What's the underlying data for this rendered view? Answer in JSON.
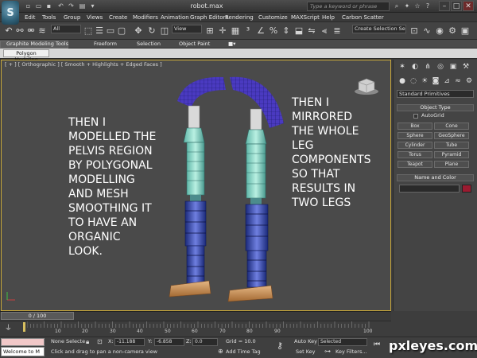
{
  "app": {
    "logo_glyph": "S",
    "window_title": "robot.max",
    "search_placeholder": "Type a keyword or phrase"
  },
  "menu": [
    "Edit",
    "Tools",
    "Group",
    "Views",
    "Create",
    "Modifiers",
    "Animation",
    "Graph Editors",
    "Rendering",
    "Customize",
    "MAXScript",
    "Help",
    "Carbon Scatter"
  ],
  "toolbar": {
    "selection_filter": "All",
    "reference_coord": "View",
    "named_selection": "Create Selection Se"
  },
  "ribbon": {
    "tabs": [
      "Graphite Modeling Tools",
      "Freeform",
      "Selection",
      "Object Paint"
    ],
    "subtab": "Polygon Modeling"
  },
  "viewport": {
    "label": "[ + ] [ Orthographic ] [ Smooth + Highlights + Edged Faces ]",
    "note_left": "THEN I\nMODELLED THE\nPELVIS REGION\nBY POLYGONAL\nMODELLING\nAND MESH\nSMOOTHING IT\nTO HAVE AN\nORGANIC\nLOOK.",
    "note_right": "THEN I\nMIRRORED\nTHE WHOLE\nLEG\nCOMPONENTS\nSO THAT\nRESULTS IN\nTWO LEGS"
  },
  "command_panel": {
    "category": "Standard Primitives",
    "object_type_title": "Object Type",
    "autogrid": "AutoGrid",
    "buttons": [
      "Box",
      "Cone",
      "Sphere",
      "GeoSphere",
      "Cylinder",
      "Tube",
      "Torus",
      "Pyramid",
      "Teapot",
      "Plane"
    ],
    "name_color_title": "Name and Color",
    "object_color": "#9b1b30"
  },
  "timeline": {
    "frame_display": "0 / 100",
    "ticks": [
      "10",
      "20",
      "30",
      "40",
      "50",
      "60",
      "70",
      "80",
      "90",
      "100"
    ]
  },
  "status": {
    "listener_text": "Welcome to M",
    "selection": "None Selecte",
    "x_label": "X:",
    "x_value": "-11.188",
    "y_label": "Y:",
    "y_value": "-6.858",
    "z_label": "Z:",
    "z_value": "0.0",
    "grid": "Grid = 10.0",
    "prompt": "Click and drag to pan a non-camera view",
    "add_time_tag": "Add Time Tag",
    "auto_key": "Auto Key",
    "key_mode": "Selected",
    "set_key": "Set Key",
    "key_filters": "Key Filters..."
  },
  "watermark": "pxleyes.com"
}
